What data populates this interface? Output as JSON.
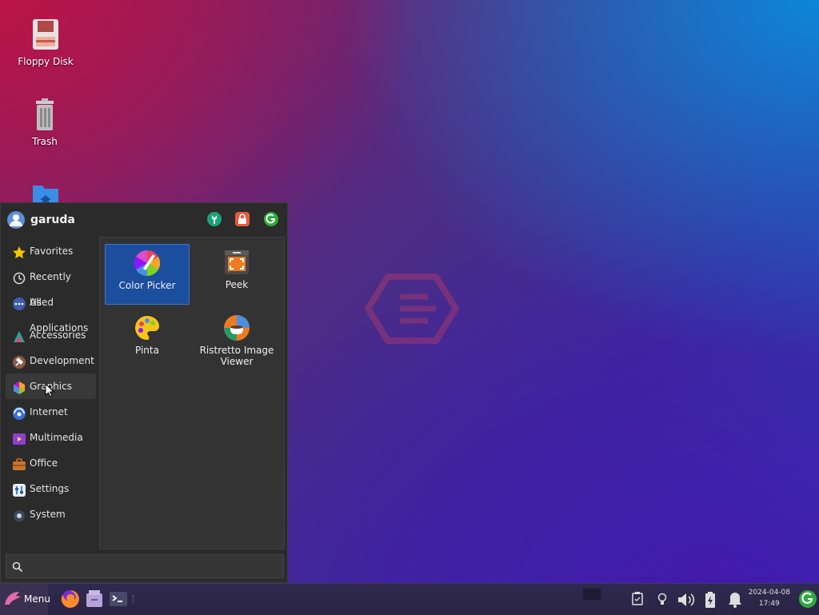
{
  "desktop": {
    "icons": [
      {
        "label": "Floppy Disk",
        "icon": "floppy-disk-icon"
      },
      {
        "label": "Trash",
        "icon": "trash-icon"
      },
      {
        "label": "",
        "icon": "home-folder-icon"
      }
    ]
  },
  "menu": {
    "user": "garuda",
    "header_buttons": [
      "settings-icon",
      "lock-icon",
      "logout-icon"
    ],
    "categories": [
      {
        "label": "Favorites",
        "icon": "star-icon"
      },
      {
        "label": "Recently Used",
        "icon": "clock-icon"
      },
      {
        "label": "All Applications",
        "icon": "dots-icon"
      },
      {
        "label": "Accessories",
        "icon": "accessories-icon"
      },
      {
        "label": "Development",
        "icon": "hammer-icon"
      },
      {
        "label": "Graphics",
        "icon": "graphics-icon",
        "selected": true
      },
      {
        "label": "Internet",
        "icon": "globe-icon"
      },
      {
        "label": "Multimedia",
        "icon": "multimedia-icon"
      },
      {
        "label": "Office",
        "icon": "briefcase-icon"
      },
      {
        "label": "Settings",
        "icon": "settings-icon"
      },
      {
        "label": "System",
        "icon": "system-icon"
      }
    ],
    "apps": [
      {
        "label": "Color Picker",
        "icon": "color-picker-icon",
        "selected": true
      },
      {
        "label": "Peek",
        "icon": "peek-icon"
      },
      {
        "label": "Pinta",
        "icon": "palette-icon"
      },
      {
        "label": "Ristretto Image Viewer",
        "icon": "ristretto-icon"
      }
    ],
    "search": {
      "value": "",
      "placeholder": ""
    }
  },
  "taskbar": {
    "menu_label": "Menu",
    "date": "2024-04-08",
    "time": "17:49"
  },
  "colors": {
    "accent": "#1c4e9e",
    "menu_bg": "#2b2b2b",
    "taskbar_bg": "#2f2a4e"
  }
}
